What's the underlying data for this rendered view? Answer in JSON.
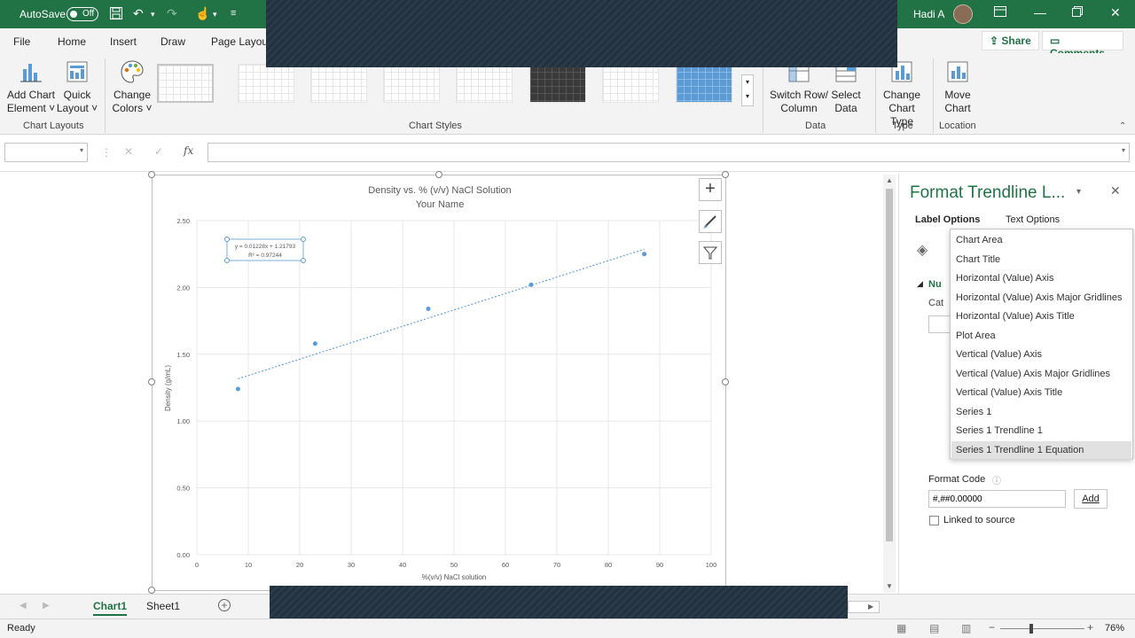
{
  "titlebar": {
    "autosave_label": "AutoSave",
    "autosave_state": "Off",
    "user_name": "Hadi A",
    "window_controls": [
      "restore-icon",
      "minimize-icon",
      "maximize-icon",
      "close-icon"
    ]
  },
  "menu": {
    "tabs": [
      "File",
      "Home",
      "Insert",
      "Draw",
      "Page Layou"
    ],
    "share_label": "Share",
    "comments_label": "Comments"
  },
  "ribbon": {
    "add_chart_element": [
      "Add Chart",
      "Element ˅"
    ],
    "quick_layout": [
      "Quick",
      "Layout ˅"
    ],
    "change_colors": [
      "Change",
      "Colors ˅"
    ],
    "switch_row_column": [
      "Switch Row/",
      "Column"
    ],
    "select_data": [
      "Select",
      "Data"
    ],
    "change_chart_type": [
      "Change",
      "Chart Type"
    ],
    "move_chart": [
      "Move",
      "Chart"
    ],
    "groups": {
      "chart_layouts": "Chart Layouts",
      "chart_styles": "Chart Styles",
      "data": "Data",
      "type": "Type",
      "location": "Location"
    }
  },
  "formula_bar": {
    "name_box_value": "",
    "formula_value": "",
    "fx_label": "fx"
  },
  "chart_data": {
    "type": "scatter",
    "title": "Density vs. % (v/v) NaCl Solution",
    "subtitle": "Your Name",
    "xlabel": "%(v/v) NaCl solution",
    "ylabel": "Density (g/mL)",
    "xlim": [
      0,
      100
    ],
    "ylim": [
      0,
      2.5
    ],
    "x_ticks": [
      0,
      10,
      20,
      30,
      40,
      50,
      60,
      70,
      80,
      90,
      100
    ],
    "y_ticks": [
      "0.00",
      "0.50",
      "1.00",
      "1.50",
      "2.00",
      "2.50"
    ],
    "x_tick_values": [
      0,
      10,
      20,
      30,
      40,
      50,
      60,
      70,
      80,
      90,
      100
    ],
    "y_tick_values": [
      0,
      0.5,
      1.0,
      1.5,
      2.0,
      2.5
    ],
    "grid": true,
    "series": [
      {
        "points": [
          {
            "x": 8,
            "y": 1.24
          },
          {
            "x": 23,
            "y": 1.58
          },
          {
            "x": 45,
            "y": 1.84
          },
          {
            "x": 65,
            "y": 2.02
          },
          {
            "x": 87,
            "y": 2.25
          }
        ],
        "color": "#5b9bd5"
      }
    ],
    "trendline": {
      "type": "linear",
      "x_start": 8,
      "x_end": 87,
      "slope": 0.01228,
      "intercept": 1.21793,
      "equation": "y = 0.01228x + 1.21793",
      "r_squared": "R² = 0.97244",
      "color": "#5b9bd5"
    }
  },
  "format_pane": {
    "title": "Format Trendline L...",
    "label_options": "Label Options",
    "text_options": "Text Options",
    "number_section": "Nu",
    "category_label": "Cat",
    "format_code_label": "Format Code",
    "format_code_value": "#,##0.00000",
    "add_button": "Add",
    "linked_to_source": "Linked to source",
    "dropdown_items": [
      "Chart Area",
      "Chart Title",
      "Horizontal (Value) Axis",
      "Horizontal (Value) Axis Major Gridlines",
      "Horizontal (Value) Axis Title",
      "Plot Area",
      "Vertical (Value) Axis",
      "Vertical (Value) Axis Major Gridlines",
      "Vertical (Value) Axis Title",
      "Series 1",
      "Series 1 Trendline 1",
      "Series 1 Trendline 1 Equation"
    ],
    "dropdown_selected": "Series 1 Trendline 1 Equation"
  },
  "sheets": {
    "tabs": [
      "Chart1",
      "Sheet1"
    ],
    "active": "Chart1"
  },
  "status": {
    "ready": "Ready",
    "zoom": "76%"
  },
  "colors": {
    "excel_green": "#217346",
    "series_blue": "#5b9bd5"
  }
}
